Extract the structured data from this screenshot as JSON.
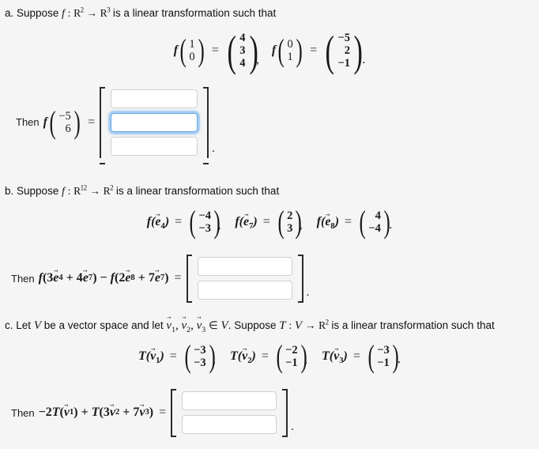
{
  "document": {
    "background_color": "#f5f5f5",
    "text_color": "#111111",
    "focus_color": "#63a8e8"
  },
  "parts": [
    {
      "id": "a",
      "label": "a.",
      "prompt_pre": "Suppose",
      "function_name": "f",
      "colon": ":",
      "domain": "R",
      "domain_exp": "2",
      "arrow": "→",
      "codomain": "R",
      "codomain_exp": "3",
      "prompt_post": "is a linear transformation such that",
      "givens": [
        {
          "function": "f",
          "input": [
            "1",
            "0"
          ],
          "output": [
            "4",
            "3",
            "4"
          ],
          "separator": ","
        },
        {
          "function": "f",
          "input": [
            "0",
            "1"
          ],
          "output": [
            "−5",
            "2",
            "−1"
          ],
          "separator": "."
        }
      ],
      "answer": {
        "then_word": "Then",
        "function": "f",
        "input": [
          "−5",
          "6"
        ],
        "equals": "=",
        "boxes": [
          {
            "value": "",
            "focused": false
          },
          {
            "value": "",
            "focused": true
          },
          {
            "value": "",
            "focused": false
          }
        ],
        "trailing": "."
      }
    },
    {
      "id": "b",
      "label": "b.",
      "prompt_pre": "Suppose",
      "function_name": "f",
      "colon": ":",
      "domain": "R",
      "domain_exp": "12",
      "arrow": "→",
      "codomain": "R",
      "codomain_exp": "2",
      "prompt_post": "is a linear transformation such that",
      "givens": [
        {
          "function": "f",
          "arg_symbol": "e",
          "arg_sub": "4",
          "output": [
            "−4",
            "−3"
          ],
          "separator": ","
        },
        {
          "function": "f",
          "arg_symbol": "e",
          "arg_sub": "7",
          "output": [
            "2",
            "3"
          ],
          "separator": ","
        },
        {
          "function": "f",
          "arg_symbol": "e",
          "arg_sub": "8",
          "output": [
            "4",
            "−4"
          ],
          "separator": "."
        }
      ],
      "answer": {
        "then_word": "Then",
        "expression_parts": [
          {
            "type": "fn",
            "text": "f"
          },
          {
            "type": "plain",
            "text": "("
          },
          {
            "type": "plain",
            "text": "3"
          },
          {
            "type": "vec",
            "symbol": "e",
            "sub": "4"
          },
          {
            "type": "plain",
            "text": " + "
          },
          {
            "type": "plain",
            "text": "4"
          },
          {
            "type": "vec",
            "symbol": "e",
            "sub": "7"
          },
          {
            "type": "plain",
            "text": ")"
          },
          {
            "type": "plain",
            "text": " − "
          },
          {
            "type": "fn",
            "text": "f"
          },
          {
            "type": "plain",
            "text": "("
          },
          {
            "type": "plain",
            "text": "2"
          },
          {
            "type": "vec",
            "symbol": "e",
            "sub": "8"
          },
          {
            "type": "plain",
            "text": " + "
          },
          {
            "type": "plain",
            "text": "7"
          },
          {
            "type": "vec",
            "symbol": "e",
            "sub": "7"
          },
          {
            "type": "plain",
            "text": ")"
          }
        ],
        "expression_text": "f(3e⃗₄ + 4e⃗₇) − f(2e⃗₈ + 7e⃗₇)",
        "equals": "=",
        "boxes": [
          {
            "value": "",
            "focused": false
          },
          {
            "value": "",
            "focused": false
          }
        ],
        "trailing": "."
      }
    },
    {
      "id": "c",
      "label": "c.",
      "prompt_text_1": "Let",
      "space_symbol": "V",
      "prompt_text_2": "be a vector space and let",
      "vectors": [
        "v⃗1",
        "v⃗2",
        "v⃗3"
      ],
      "membership": "∈",
      "prompt_text_3": "Suppose",
      "transform_name": "T",
      "colon": ":",
      "domain": "V",
      "arrow": "→",
      "codomain": "R",
      "codomain_exp": "2",
      "prompt_post": "is a linear transformation such that",
      "givens": [
        {
          "function": "T",
          "arg_symbol": "v",
          "arg_sub": "1",
          "output": [
            "−3",
            "−3"
          ],
          "separator": ","
        },
        {
          "function": "T",
          "arg_symbol": "v",
          "arg_sub": "2",
          "output": [
            "−2",
            "−1"
          ],
          "separator": ","
        },
        {
          "function": "T",
          "arg_symbol": "v",
          "arg_sub": "3",
          "output": [
            "−3",
            "−1"
          ],
          "separator": "."
        }
      ],
      "answer": {
        "then_word": "Then",
        "expression_text": "−2T(v⃗₁) + T(3v⃗₂ + 7v⃗₃)",
        "equals": "=",
        "boxes": [
          {
            "value": "",
            "focused": false
          },
          {
            "value": "",
            "focused": false
          }
        ],
        "trailing": "."
      }
    }
  ]
}
